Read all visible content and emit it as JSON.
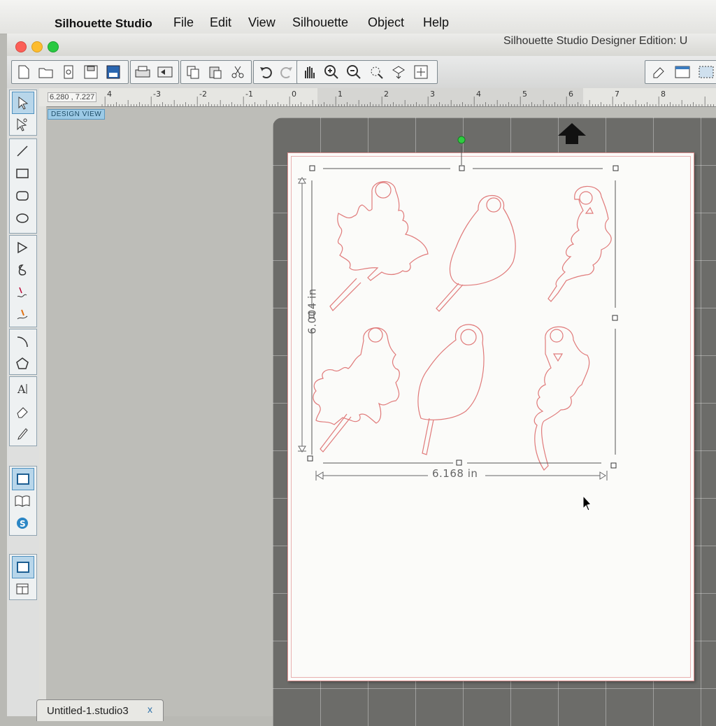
{
  "menubar": {
    "app_name": "Silhouette Studio",
    "menus": [
      "File",
      "Edit",
      "View",
      "Silhouette",
      "Object",
      "Help"
    ]
  },
  "window": {
    "title": "Silhouette Studio Designer Edition: U"
  },
  "toolbar": {
    "groups": [
      [
        "new-document-icon",
        "open-folder-icon",
        "open-library-icon",
        "save-icon",
        "save-to-library-icon"
      ],
      [
        "print-icon",
        "send-to-cut-icon"
      ],
      [
        "copy-icon",
        "paste-icon",
        "cut-scissors-icon"
      ],
      [
        "undo-icon",
        "redo-icon"
      ],
      [
        "pan-hand-icon",
        "zoom-in-icon",
        "zoom-out-icon",
        "zoom-select-icon",
        "drag-zoom-icon",
        "fit-to-page-icon"
      ]
    ]
  },
  "ruler": {
    "coords": "6.280 , 7.227",
    "ticks": [
      "4",
      "-3",
      "-2",
      "-1",
      "0",
      "1",
      "2",
      "3",
      "4",
      "5",
      "6",
      "7",
      "8"
    ]
  },
  "view_label": "DESIGN VIEW",
  "selection": {
    "width_label": "6.168 in",
    "height_label": "6.004 in"
  },
  "document_tab": {
    "label": "Untitled-1.studio3",
    "close": "x"
  },
  "colors": {
    "cut_line": "#e07a7a",
    "selection_handle": "#333333",
    "rotate_handle": "#2ecc40",
    "mat": "#6c6c69"
  }
}
